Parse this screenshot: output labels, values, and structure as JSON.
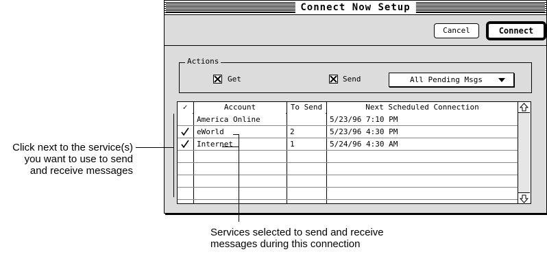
{
  "window": {
    "title": "Connect Now Setup",
    "buttons": {
      "cancel": "Cancel",
      "connect": "Connect"
    }
  },
  "actions": {
    "group_label": "Actions",
    "get": {
      "label": "Get",
      "checked": true
    },
    "send": {
      "label": "Send",
      "checked": true
    },
    "send_popup": {
      "value": "All Pending Msgs"
    }
  },
  "table": {
    "headers": {
      "check": "✓",
      "account": "Account",
      "to_send": "To Send",
      "next": "Next Scheduled Connection"
    },
    "rows": [
      {
        "checked": false,
        "account": "America Online",
        "to_send": "",
        "next": "5/23/96 7:10 PM"
      },
      {
        "checked": true,
        "account": "eWorld",
        "to_send": "2",
        "next": "5/23/96 4:30 PM"
      },
      {
        "checked": true,
        "account": "Internet",
        "to_send": "1",
        "next": "5/24/96 4:30 AM"
      },
      {
        "checked": false,
        "account": "",
        "to_send": "",
        "next": ""
      },
      {
        "checked": false,
        "account": "",
        "to_send": "",
        "next": ""
      },
      {
        "checked": false,
        "account": "",
        "to_send": "",
        "next": ""
      },
      {
        "checked": false,
        "account": "",
        "to_send": "",
        "next": ""
      }
    ]
  },
  "callouts": {
    "left": [
      "Click next to the service(s)",
      "you want to use to send",
      "and receive messages"
    ],
    "bottom": [
      "Services selected to send and receive",
      "messages during this connection"
    ]
  }
}
